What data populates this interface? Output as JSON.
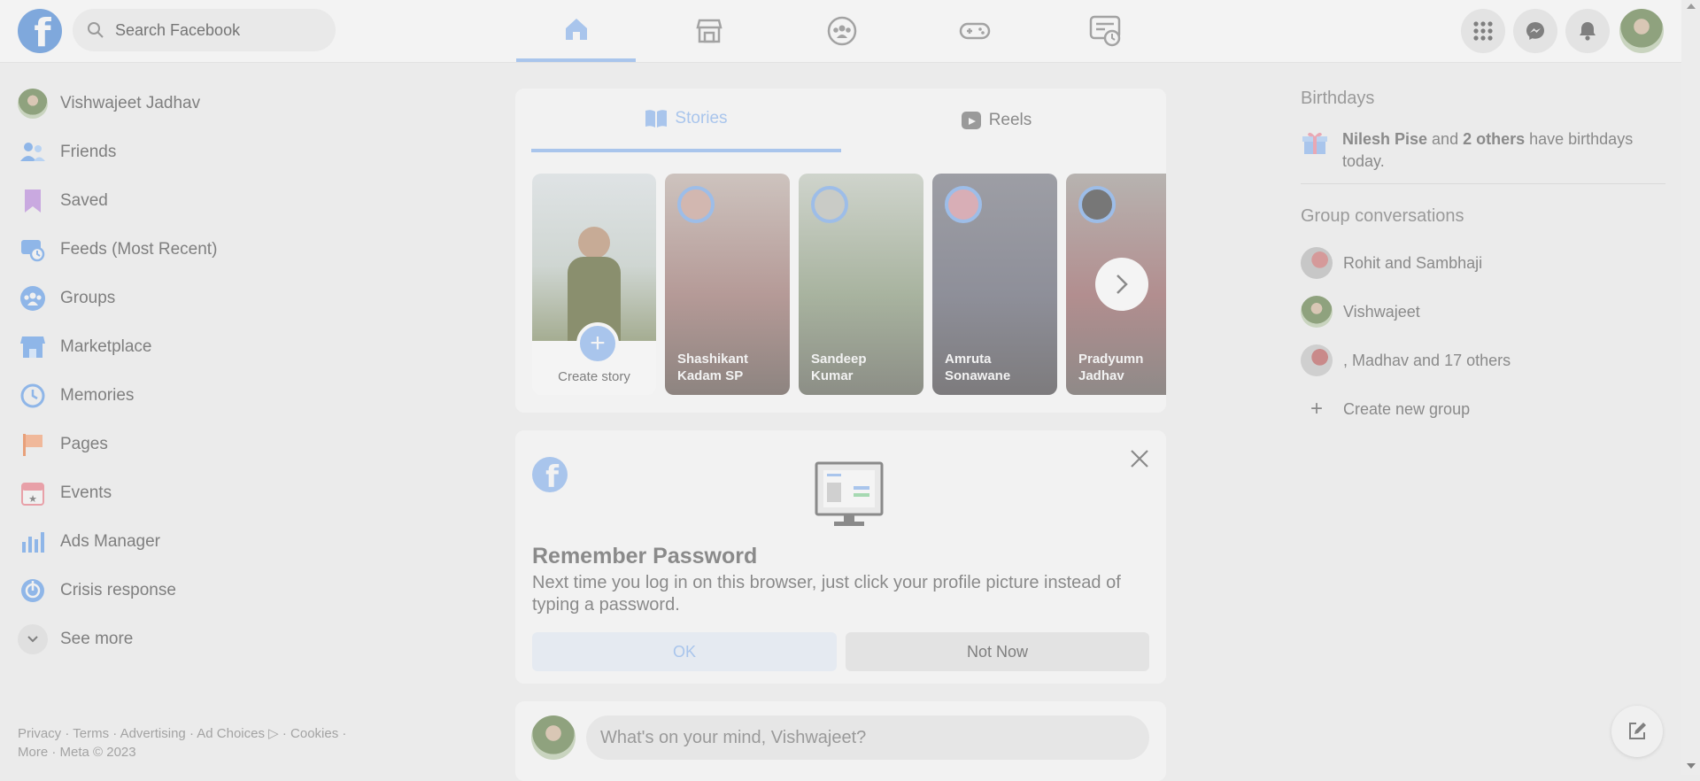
{
  "search": {
    "placeholder": "Search Facebook"
  },
  "nav": {
    "tabs": [
      "home",
      "marketplace",
      "groups",
      "gaming",
      "feeds"
    ],
    "active": "home"
  },
  "sidebar": {
    "profile": "Vishwajeet Jadhav",
    "items": [
      {
        "label": "Friends",
        "icon": "friends-icon"
      },
      {
        "label": "Saved",
        "icon": "saved-icon"
      },
      {
        "label": "Feeds (Most Recent)",
        "icon": "feeds-icon"
      },
      {
        "label": "Groups",
        "icon": "groups-icon"
      },
      {
        "label": "Marketplace",
        "icon": "marketplace-icon"
      },
      {
        "label": "Memories",
        "icon": "memories-icon"
      },
      {
        "label": "Pages",
        "icon": "pages-icon"
      },
      {
        "label": "Events",
        "icon": "events-icon"
      },
      {
        "label": "Ads Manager",
        "icon": "ads-manager-icon"
      },
      {
        "label": "Crisis response",
        "icon": "crisis-response-icon"
      }
    ],
    "see_more": "See more"
  },
  "footer": {
    "line1": "Privacy · Terms · Advertising · Ad Choices",
    "cookies": "· Cookies ·",
    "line2": "More · Meta © 2023"
  },
  "stories": {
    "tab_stories": "Stories",
    "tab_reels": "Reels",
    "create": "Create story",
    "items": [
      {
        "line1": "Shashikant",
        "line2": "Kadam SP"
      },
      {
        "line1": "Sandeep",
        "line2": "Kumar"
      },
      {
        "line1": "Amruta",
        "line2": "Sonawane"
      },
      {
        "line1": "Pradyumn",
        "line2": "Jadhav"
      }
    ]
  },
  "remember": {
    "title": "Remember Password",
    "body": "Next time you log in on this browser, just click your profile picture instead of typing a password.",
    "ok": "OK",
    "not_now": "Not Now"
  },
  "composer": {
    "placeholder": "What's on your mind, Vishwajeet?"
  },
  "right": {
    "birthdays_title": "Birthdays",
    "bday_name": "Nilesh Pise",
    "bday_and": " and ",
    "bday_others": "2 others",
    "bday_rest": " have birthdays today.",
    "groups_title": "Group conversations",
    "groups": [
      "Rohit and Sambhaji",
      "Vishwajeet",
      ", Madhav and 17 others"
    ],
    "create_group": "Create new group"
  },
  "colors": {
    "accent": "#a9c5ec",
    "page_bg": "#ebebeb",
    "card_bg": "#f2f2f2"
  }
}
